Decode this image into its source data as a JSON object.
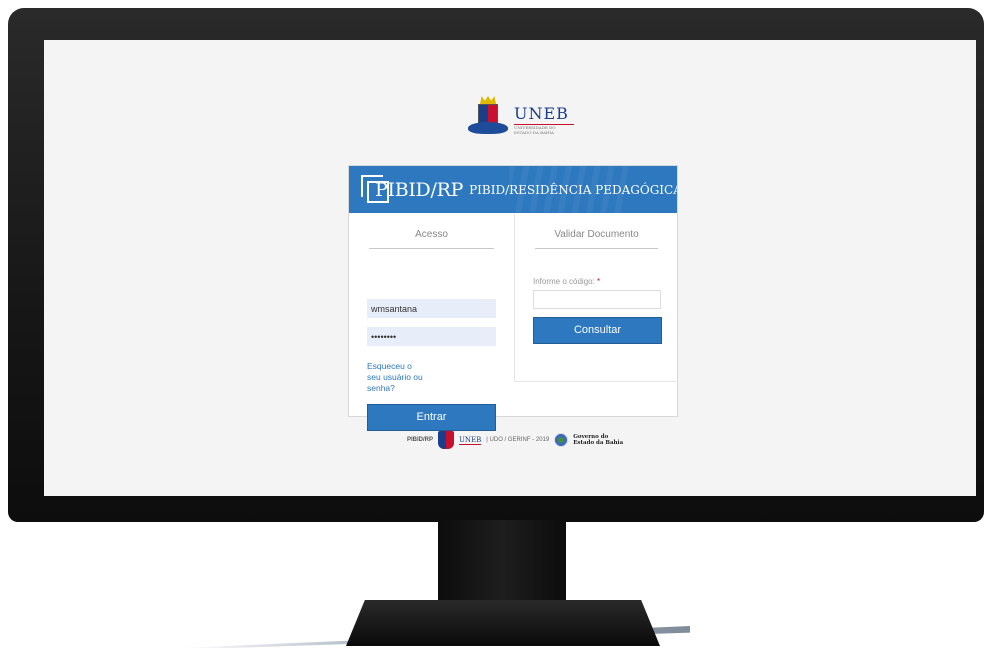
{
  "logo": {
    "name": "UNEB",
    "subtitle_line1": "UNIVERSIDADE DO",
    "subtitle_line2": "ESTADO DA BAHIA"
  },
  "header": {
    "title": "PIBID/RP",
    "subtitle": "PIBID/RESIDÊNCIA PEDAGÓGICA",
    "color": "#2d78bf"
  },
  "login": {
    "title": "Acesso",
    "username_value": "wmsantana",
    "password_value": "••••••••",
    "forgot_line1": "Esqueceu o",
    "forgot_line2": "seu usuário ou",
    "forgot_line3": "senha?",
    "submit_label": "Entrar"
  },
  "validate": {
    "title": "Validar Documento",
    "code_label": "Informe o código:",
    "required_mark": "*",
    "submit_label": "Consultar"
  },
  "footer": {
    "app_name": "PIBID/RP",
    "uneb_label": "UNEB",
    "credit": "| UDO / GERINF - 2019",
    "gov_line1": "Governo do",
    "gov_line2": "Estado da Bahia"
  }
}
